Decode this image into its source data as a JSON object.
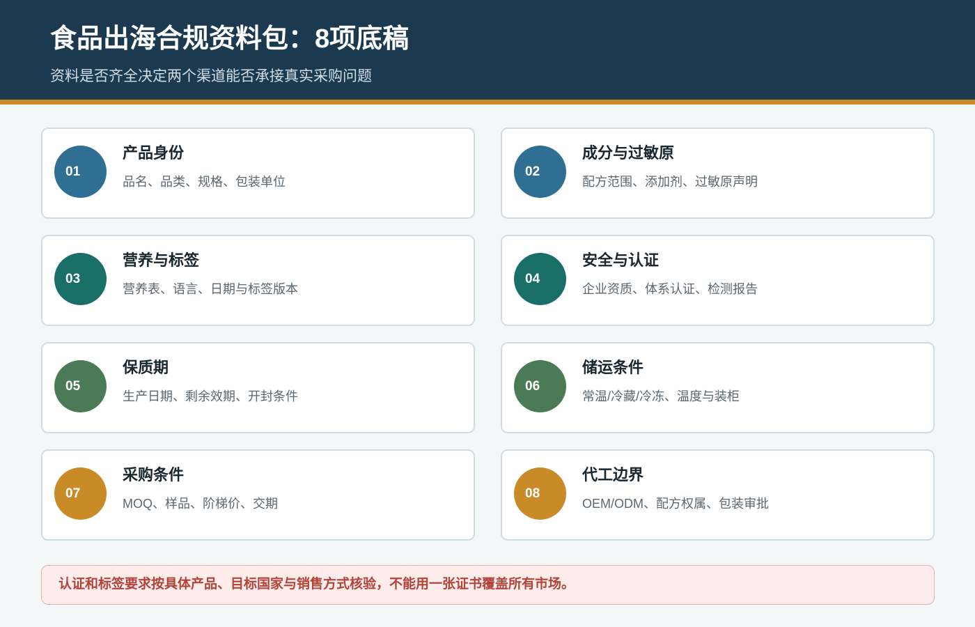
{
  "colors": {
    "header_bg": "#1b3a50",
    "header_accent_bar": "#c98a2a",
    "page_bg": "#f4f7f8",
    "notice_bg": "#fdecea",
    "notice_text": "#b0443a"
  },
  "header": {
    "title": "食品出海合规资料包：8项底稿",
    "subtitle": "资料是否齐全决定两个渠道能否承接真实采购问题"
  },
  "items": [
    {
      "number": "01",
      "title": "产品身份",
      "desc": "品名、品类、规格、包装单位",
      "color": "#2e6f93"
    },
    {
      "number": "02",
      "title": "成分与过敏原",
      "desc": "配方范围、添加剂、过敏原声明",
      "color": "#2e6f93"
    },
    {
      "number": "03",
      "title": "营养与标签",
      "desc": "营养表、语言、日期与标签版本",
      "color": "#1a6e68"
    },
    {
      "number": "04",
      "title": "安全与认证",
      "desc": "企业资质、体系认证、检测报告",
      "color": "#1a6e68"
    },
    {
      "number": "05",
      "title": "保质期",
      "desc": "生产日期、剩余效期、开封条件",
      "color": "#4b7a57"
    },
    {
      "number": "06",
      "title": "储运条件",
      "desc": "常温/冷藏/冷冻、温度与装柜",
      "color": "#4b7a57"
    },
    {
      "number": "07",
      "title": "采购条件",
      "desc": "MOQ、样品、阶梯价、交期",
      "color": "#c98b28"
    },
    {
      "number": "08",
      "title": "代工边界",
      "desc": "OEM/ODM、配方权属、包装审批",
      "color": "#c98b28"
    }
  ],
  "notice": {
    "text": "认证和标签要求按具体产品、目标国家与销售方式核验，不能用一张证书覆盖所有市场。"
  }
}
